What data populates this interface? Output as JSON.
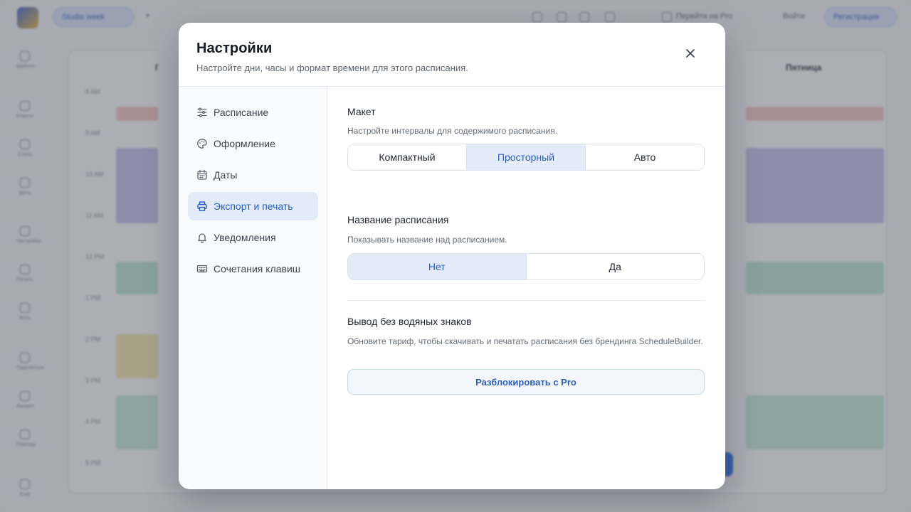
{
  "background": {
    "schedule_chip": "Studio week",
    "login_text": "Войти",
    "signup_text": "Регистрация",
    "upgrade_text": "Перейти на Pro",
    "col_head_left": "Пн",
    "col_head_right": "Пятница",
    "times": [
      "8 AM",
      "9 AM",
      "10 AM",
      "11 AM",
      "12 PM",
      "1 PM",
      "2 PM",
      "3 PM",
      "4 PM",
      "5 PM"
    ],
    "rail": [
      "Шаблон",
      "Классы",
      "Стиль",
      "Даты",
      "Настройки",
      "Печать",
      "Фото",
      "Поделиться",
      "Аккаунт",
      "Помощь",
      "Ещё"
    ]
  },
  "modal": {
    "title": "Настройки",
    "subtitle": "Настройте дни, часы и формат времени для этого расписания.",
    "nav": [
      {
        "label": "Расписание",
        "icon": "sliders-icon"
      },
      {
        "label": "Оформление",
        "icon": "palette-icon"
      },
      {
        "label": "Даты",
        "icon": "calendar-icon"
      },
      {
        "label": "Экспорт и печать",
        "icon": "printer-icon"
      },
      {
        "label": "Уведомления",
        "icon": "bell-icon"
      },
      {
        "label": "Сочетания клавиш",
        "icon": "keyboard-icon"
      }
    ],
    "active_nav_index": 3,
    "layout": {
      "title": "Макет",
      "desc": "Настройте интервалы для содержимого расписания.",
      "options": [
        "Компактный",
        "Просторный",
        "Авто"
      ],
      "selected_index": 1
    },
    "schedule_name": {
      "title": "Название расписания",
      "desc": "Показывать название над расписанием.",
      "options": [
        "Нет",
        "Да"
      ],
      "selected_index": 0
    },
    "watermark": {
      "title": "Вывод без водяных знаков",
      "desc": "Обновите тариф, чтобы скачивать и печатать расписания без брендинга ScheduleBuilder.",
      "button": "Разблокировать с Pro"
    }
  },
  "colors": {
    "accent": "#2c5fc3",
    "selected_bg": "#e3ebf8",
    "overlay": "#3f424e"
  }
}
